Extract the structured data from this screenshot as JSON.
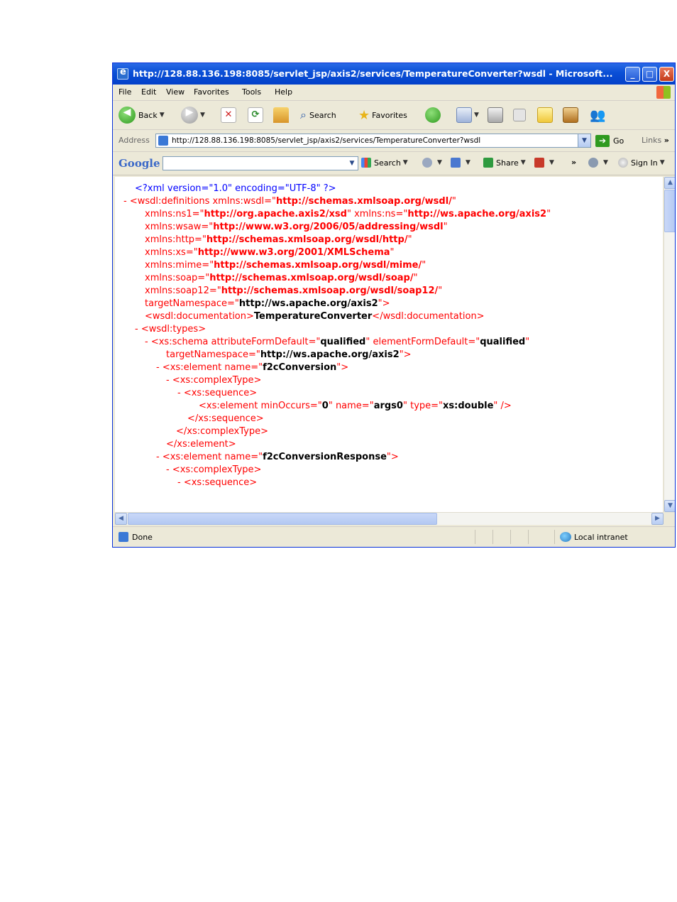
{
  "window": {
    "title": "http://128.88.136.198:8085/servlet_jsp/axis2/services/TemperatureConverter?wsdl - Microsoft...",
    "minimize_glyph": "_",
    "maximize_glyph": "□",
    "close_glyph": "X"
  },
  "menu": [
    "File",
    "Edit",
    "View",
    "Favorites",
    "Tools",
    "Help"
  ],
  "toolbar": {
    "back_label": "Back",
    "search_label": "Search",
    "favorites_label": "Favorites"
  },
  "address": {
    "label": "Address",
    "url": "http://128.88.136.198:8085/servlet_jsp/axis2/services/TemperatureConverter?wsdl",
    "go_label": "Go",
    "links_label": "Links",
    "more_glyph": "»"
  },
  "google": {
    "logo": "Google",
    "search_label": "Search",
    "share_label": "Share",
    "sign_in_label": "Sign In",
    "more_glyph": "»"
  },
  "xml": {
    "line1": {
      "pi": "<?xml version=\"1.0\" encoding=\"UTF-8\" ?>"
    },
    "line2": {
      "minus": "-",
      "open": "<wsdl:definitions ",
      "attr": "xmlns:wsdl=\"",
      "val": "http://schemas.xmlsoap.org/wsdl/",
      "close": "\""
    },
    "line3": {
      "attr1": "xmlns:ns1=\"",
      "val1": "http://org.apache.axis2/xsd",
      "q1": "\" ",
      "attr2": "xmlns:ns=\"",
      "val2": "http://ws.apache.org/axis2",
      "q2": "\""
    },
    "line4": {
      "attr": "xmlns:wsaw=\"",
      "val": "http://www.w3.org/2006/05/addressing/wsdl",
      "q": "\""
    },
    "line5": {
      "attr": "xmlns:http=\"",
      "val": "http://schemas.xmlsoap.org/wsdl/http/",
      "q": "\""
    },
    "line6": {
      "attr": "xmlns:xs=\"",
      "val": "http://www.w3.org/2001/XMLSchema",
      "q": "\""
    },
    "line7": {
      "attr": "xmlns:mime=\"",
      "val": "http://schemas.xmlsoap.org/wsdl/mime/",
      "q": "\""
    },
    "line8": {
      "attr": "xmlns:soap=\"",
      "val": "http://schemas.xmlsoap.org/wsdl/soap/",
      "q": "\""
    },
    "line9": {
      "attr": "xmlns:soap12=\"",
      "val": "http://schemas.xmlsoap.org/wsdl/soap12/",
      "q": "\""
    },
    "line10": {
      "attr": "targetNamespace=\"",
      "val": "http://ws.apache.org/axis2",
      "q": "\">"
    },
    "line11": {
      "open": "<wsdl:documentation>",
      "text": "TemperatureConverter",
      "close": "</wsdl:documentation>"
    },
    "line12": {
      "minus": "-",
      "tag": "<wsdl:types>"
    },
    "line13": {
      "minus": "-",
      "open": "<xs:schema ",
      "attr1": "attributeFormDefault=\"",
      "val1": "qualified",
      "q1": "\" ",
      "attr2": "elementFormDefault=\"",
      "val2": "qualified",
      "q2": "\""
    },
    "line14": {
      "attr": "targetNamespace=\"",
      "val": "http://ws.apache.org/axis2",
      "q": "\">"
    },
    "line15": {
      "minus": "-",
      "open": "<xs:element ",
      "attr": "name=\"",
      "val": "f2cConversion",
      "q": "\">"
    },
    "line16": {
      "minus": "-",
      "tag": "<xs:complexType>"
    },
    "line17": {
      "minus": "-",
      "tag": "<xs:sequence>"
    },
    "line18": {
      "open": "<xs:element ",
      "attr1": "minOccurs=\"",
      "val1": "0",
      "q1": "\" ",
      "attr2": "name=\"",
      "val2": "args0",
      "q2": "\" ",
      "attr3": "type=\"",
      "val3": "xs:double",
      "q3": "\" />"
    },
    "line19": {
      "tag": "</xs:sequence>"
    },
    "line20": {
      "tag": "</xs:complexType>"
    },
    "line21": {
      "tag": "</xs:element>"
    },
    "line22": {
      "minus": "-",
      "open": "<xs:element ",
      "attr": "name=\"",
      "val": "f2cConversionResponse",
      "q": "\">"
    },
    "line23": {
      "minus": "-",
      "tag": "<xs:complexType>"
    },
    "line24": {
      "minus": "-",
      "tag": "<xs:sequence>"
    }
  },
  "status": {
    "text": "Done",
    "zone": "Local intranet"
  },
  "colors": {
    "title_bar": "#0a4fd6",
    "markup": "#ff0000",
    "processing_instruction": "#0000ff"
  }
}
